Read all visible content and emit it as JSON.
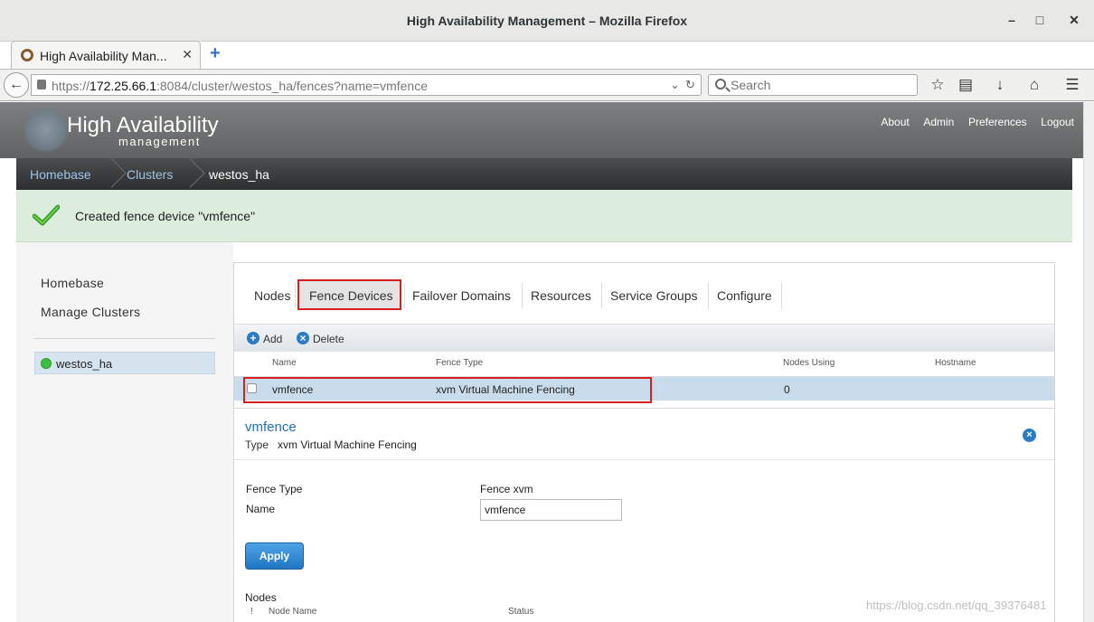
{
  "window": {
    "title": "High Availability Management – Mozilla Firefox"
  },
  "browser": {
    "tab_title": "High Availability Man...",
    "url_prefix": "https://",
    "url_host": "172.25.66.1",
    "url_rest": ":8084/cluster/westos_ha/fences?name=vmfence",
    "search_placeholder": "Search"
  },
  "app": {
    "logo_title": "High Availability",
    "logo_subtitle": "management",
    "top_links": [
      "About",
      "Admin",
      "Preferences",
      "Logout"
    ],
    "breadcrumb": [
      "Homebase",
      "Clusters",
      "westos_ha"
    ]
  },
  "notice": {
    "message": "Created fence device \"vmfence\""
  },
  "sidebar": {
    "links": [
      "Homebase",
      "Manage Clusters"
    ],
    "cluster": "westos_ha"
  },
  "main": {
    "tabs": [
      "Nodes",
      "Fence Devices",
      "Failover Domains",
      "Resources",
      "Service Groups",
      "Configure"
    ],
    "toolbar": {
      "add": "Add",
      "delete": "Delete"
    },
    "columns": [
      "Name",
      "Fence Type",
      "Nodes Using",
      "Hostname"
    ],
    "rows": [
      {
        "name": "vmfence",
        "fence_type": "xvm Virtual Machine Fencing",
        "nodes_using": "0",
        "hostname": ""
      }
    ]
  },
  "detail": {
    "title": "vmfence",
    "type_key": "Type",
    "type_value": "xvm Virtual Machine Fencing",
    "fence_type_label": "Fence Type",
    "fence_type_value": "Fence xvm",
    "name_label": "Name",
    "name_value": "vmfence",
    "apply": "Apply",
    "nodes_label": "Nodes",
    "node_columns": [
      "!",
      "Node Name",
      "Status"
    ]
  },
  "watermark": "https://blog.csdn.net/qq_39376481"
}
